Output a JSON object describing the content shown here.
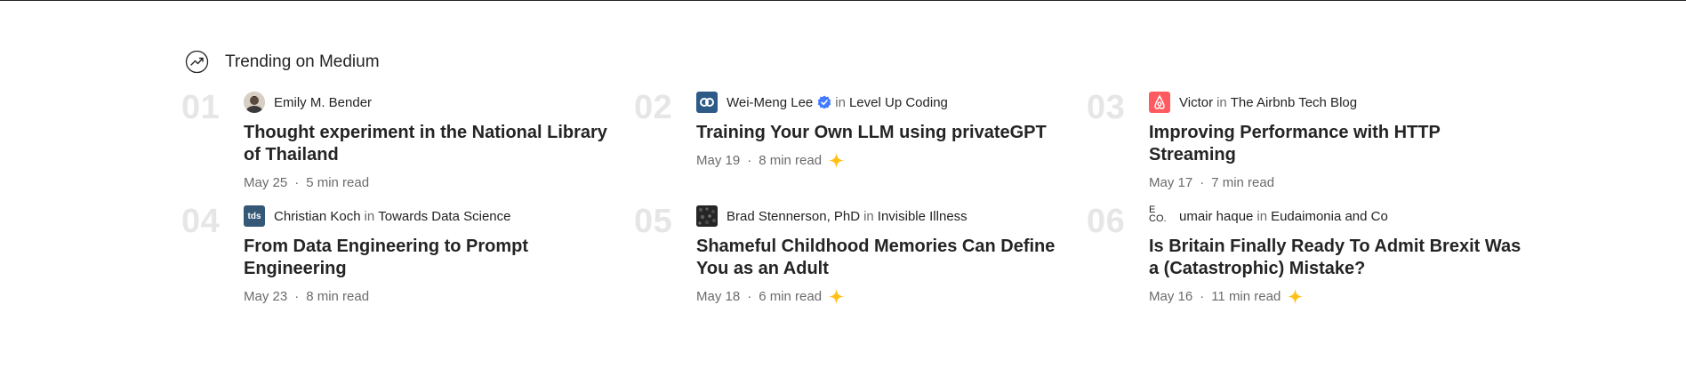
{
  "header": {
    "title": "Trending on Medium",
    "icon": "trending-icon"
  },
  "colors": {
    "star": "#FFC017",
    "number": "#E6E6E6",
    "muted": "#6B6B6B",
    "airbnb": "#FF5A5F",
    "tds": "#355876",
    "levelup": "#2E5A88"
  },
  "connector": "in",
  "meta_sep": "·",
  "items": [
    {
      "number": "01",
      "author": "Emily M. Bender",
      "publication": "",
      "title": "Thought experiment in the National Library of Thailand",
      "date": "May 25",
      "read_time": "5 min read",
      "member_only": false,
      "avatar": "author-photo"
    },
    {
      "number": "02",
      "author": "Wei-Meng Lee",
      "publication": "Level Up Coding",
      "title": "Training Your Own LLM using privateGPT",
      "date": "May 19",
      "read_time": "8 min read",
      "member_only": true,
      "avatar": "level-up-coding-logo",
      "badge": "verified-badge-icon"
    },
    {
      "number": "03",
      "author": "Victor",
      "publication": "The Airbnb Tech Blog",
      "title": "Improving Performance with HTTP Streaming",
      "date": "May 17",
      "read_time": "7 min read",
      "member_only": false,
      "avatar": "airbnb-logo"
    },
    {
      "number": "04",
      "author": "Christian Koch",
      "publication": "Towards Data Science",
      "title": "From Data Engineering to Prompt Engineering",
      "date": "May 23",
      "read_time": "8 min read",
      "member_only": false,
      "avatar": "tds-logo",
      "avatar_text": "tds"
    },
    {
      "number": "05",
      "author": "Brad Stennerson, PhD",
      "publication": "Invisible Illness",
      "title": "Shameful Childhood Memories Can Define You as an Adult",
      "date": "May 18",
      "read_time": "6 min read",
      "member_only": true,
      "avatar": "invisible-illness-logo"
    },
    {
      "number": "06",
      "author": "umair haque",
      "publication": "Eudaimonia and Co",
      "title": "Is Britain Finally Ready To Admit Brexit Was a (Catastrophic) Mistake?",
      "date": "May 16",
      "read_time": "11 min read",
      "member_only": true,
      "avatar": "eudaimonia-logo",
      "avatar_text": "E CO."
    }
  ]
}
